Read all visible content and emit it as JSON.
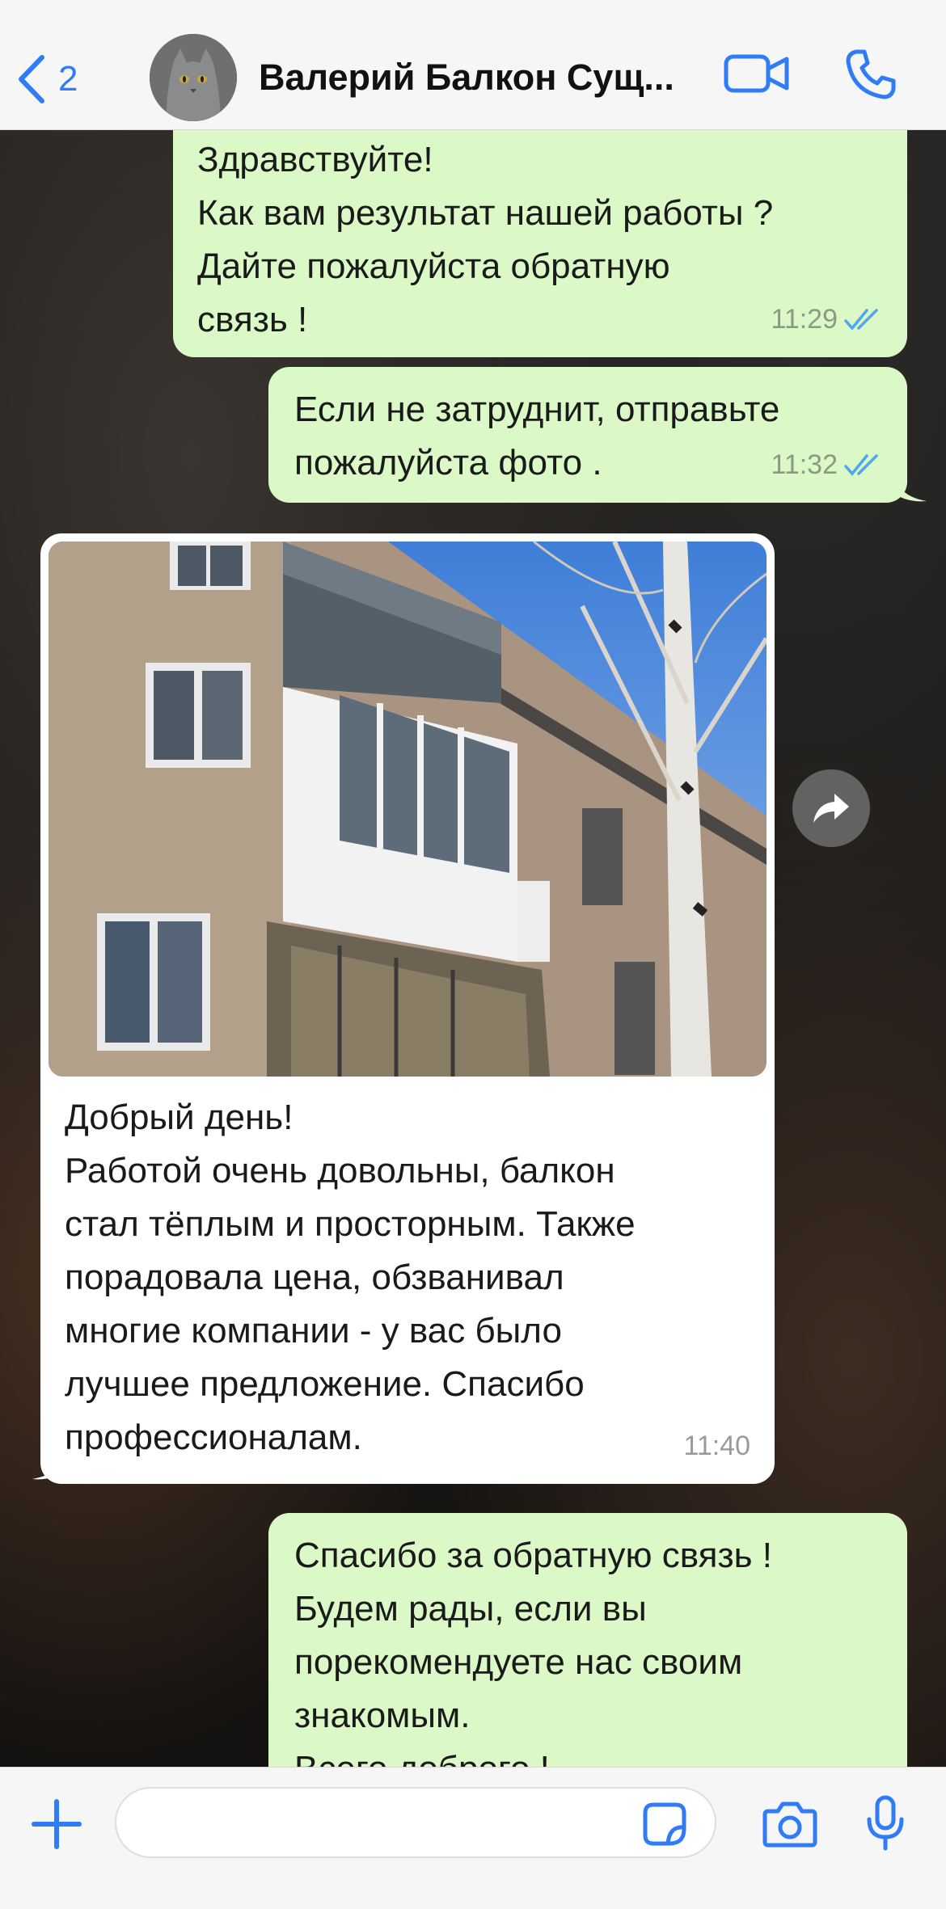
{
  "header": {
    "back_count": "2",
    "contact_name": "Валерий Балкон Сущ..."
  },
  "messages": [
    {
      "direction": "outgoing",
      "text": "Здравствуйте!\nКак вам результат нашей работы ?\nДайте пожалуйста обратную\nсвязь !",
      "time": "11:29",
      "status": "read"
    },
    {
      "direction": "outgoing",
      "text": "Если не затруднит, отправьте\nпожалуйста фото .",
      "time": "11:32",
      "status": "read"
    },
    {
      "direction": "incoming",
      "has_photo": true,
      "text": "Добрый день!\nРаботой очень довольны, балкон\nстал тёплым и просторным. Также\nпорадовала цена, обзванивал\nмногие компании - у вас было\nлучшее предложение. Спасибо\nпрофессионалам.",
      "time": "11:40"
    },
    {
      "direction": "outgoing",
      "text": "Спасибо за обратную связь !\nБудем рады, если вы\nпорекомендуете нас своим\nзнакомым.\nВсего доброго !"
    }
  ],
  "input": {
    "placeholder": ""
  },
  "icons": {
    "back": "chevron-left-icon",
    "video": "video-camera-icon",
    "call": "phone-icon",
    "forward": "forward-arrow-icon",
    "add": "plus-icon",
    "sticker": "sticker-icon",
    "camera": "camera-icon",
    "mic": "microphone-icon"
  },
  "colors": {
    "accent": "#2f7cf6",
    "outgoing_bubble": "#dbf8c7",
    "incoming_bubble": "#ffffff",
    "read_ticks": "#4fa6f0"
  }
}
